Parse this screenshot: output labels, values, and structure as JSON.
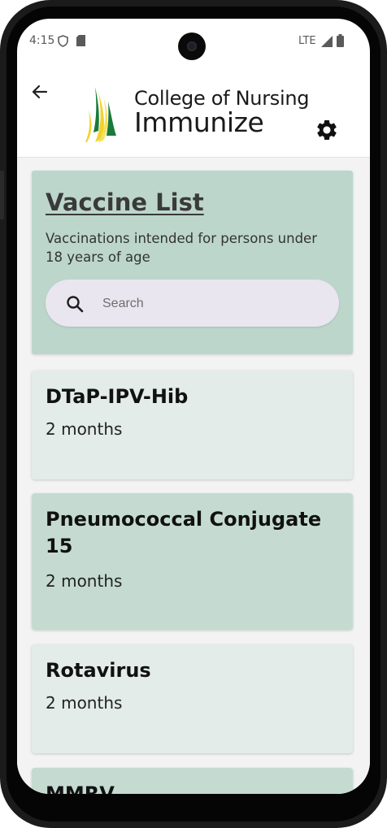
{
  "status_bar": {
    "time": "4:15",
    "network": "LTE",
    "icons": [
      "shield-icon",
      "sim-card-icon",
      "signal-icon",
      "battery-icon"
    ]
  },
  "app_bar": {
    "back_icon": "arrow-left-icon",
    "logo_line1": "College of Nursing",
    "logo_line2": "Immunize",
    "settings_icon": "gear-icon"
  },
  "vaccine_list": {
    "title": "Vaccine List",
    "subtitle": "Vaccinations intended for persons under 18 years of age",
    "search": {
      "value": "",
      "placeholder": "Search"
    }
  },
  "vaccines": [
    {
      "name": "DTaP-IPV-Hib",
      "age": "2 months"
    },
    {
      "name": "Pneumococcal Conjugate 15",
      "age": "2 months"
    },
    {
      "name": "Rotavirus",
      "age": "2 months"
    },
    {
      "name": "MMRV",
      "age": ""
    }
  ],
  "colors": {
    "header_card": "#bcd6cc",
    "card_light": "#e3ece8",
    "card_dark": "#c5dbd1",
    "logo_green": "#1a7a3a",
    "logo_yellow": "#f2d22e"
  }
}
